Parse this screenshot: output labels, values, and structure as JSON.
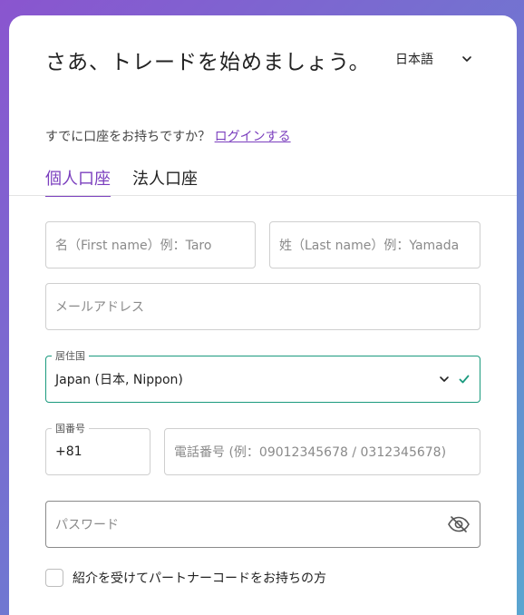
{
  "header": {
    "title": "さあ、トレードを始めましょう。",
    "language": "日本語"
  },
  "login_prompt": {
    "text": "すでに口座をお持ちですか？",
    "link": "ログインする"
  },
  "tabs": [
    {
      "label": "個人口座",
      "active": true
    },
    {
      "label": "法人口座",
      "active": false
    }
  ],
  "form": {
    "first_name_placeholder": "名（First name）例：Taro",
    "last_name_placeholder": "姓（Last name）例：Yamada",
    "email_placeholder": "メールアドレス",
    "country_label": "居住国",
    "country_value": "Japan (日本, Nippon)",
    "dial_code_label": "国番号",
    "dial_code_value": "+81",
    "phone_placeholder": "電話番号 (例：09012345678 / 0312345678)",
    "password_placeholder": "パスワード",
    "referral_checkbox_label": "紹介を受けてパートナーコードをお持ちの方"
  },
  "colors": {
    "accent": "#7b3fbe",
    "valid": "#1a9a7e"
  }
}
